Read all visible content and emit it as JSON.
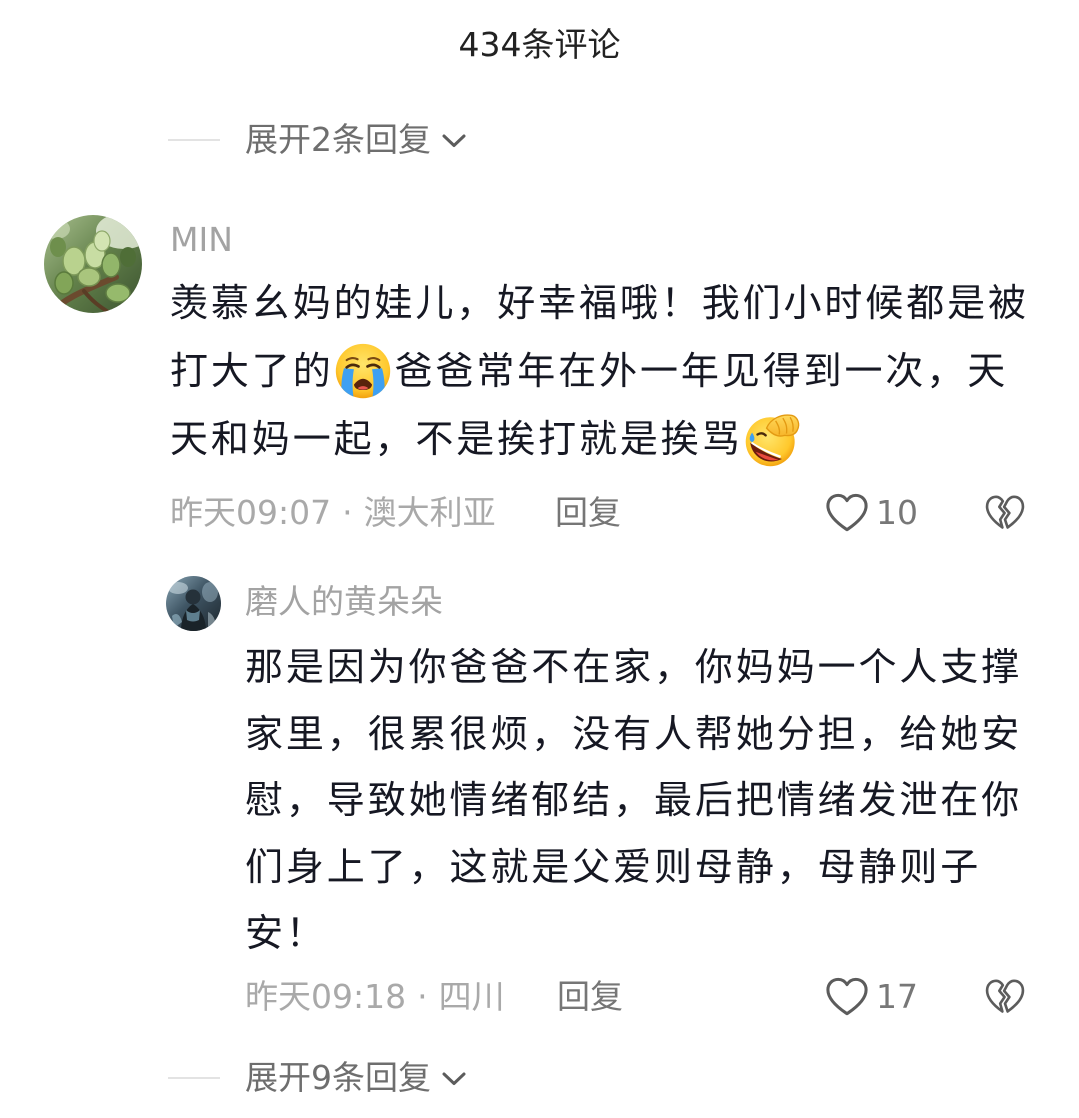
{
  "header": {
    "title": "434条评论"
  },
  "separator": "·",
  "expand_top": {
    "label": "展开2条回复",
    "icon": "chevron-down-icon"
  },
  "comment": {
    "username": "MIN",
    "text_lines": [
      [
        {
          "text": "羡慕幺妈的娃儿，好幸福哦！我们小时候都是被"
        }
      ],
      [
        {
          "text": "打大了的"
        },
        {
          "emoji": "crying-face-emoji-icon"
        },
        {
          "text": "爸爸常年在外一年见得到一次，天"
        }
      ],
      [
        {
          "text": "天和妈一起，不是挨打就是挨骂"
        },
        {
          "emoji": "facepalm-laughing-emoji-icon"
        }
      ]
    ],
    "time": "昨天09:07",
    "location": "澳大利亚",
    "reply_label": "回复",
    "like_icon": "heart-outline-icon",
    "likes": "10",
    "dislike_icon": "broken-heart-icon"
  },
  "reply": {
    "username": "磨人的黄朵朵",
    "text_lines": [
      [
        {
          "text": "那是因为你爸爸不在家，你妈妈一个人支撑"
        }
      ],
      [
        {
          "text": "家里，很累很烦，没有人帮她分担，给她安"
        }
      ],
      [
        {
          "text": "慰，导致她情绪郁结，最后把情绪发泄在你"
        }
      ],
      [
        {
          "text": "们身上了，这就是父爱则母静，母静则子"
        }
      ],
      [
        {
          "text": "安！"
        }
      ]
    ],
    "time": "昨天09:18",
    "location": "四川",
    "reply_label": "回复",
    "like_icon": "heart-outline-icon",
    "likes": "17",
    "dislike_icon": "broken-heart-icon"
  },
  "expand_bottom": {
    "label": "展开9条回复",
    "icon": "chevron-down-icon"
  },
  "colors": {
    "background": "#ffffff",
    "text_primary": "#161823",
    "text_secondary": "#a9a9a9",
    "action_text": "#767676",
    "icon_stroke": "#5c5c5c",
    "divider": "#e3e3e3",
    "tear_blue": "#3ea0f2",
    "emoji_yellow": "#ffc82c"
  }
}
